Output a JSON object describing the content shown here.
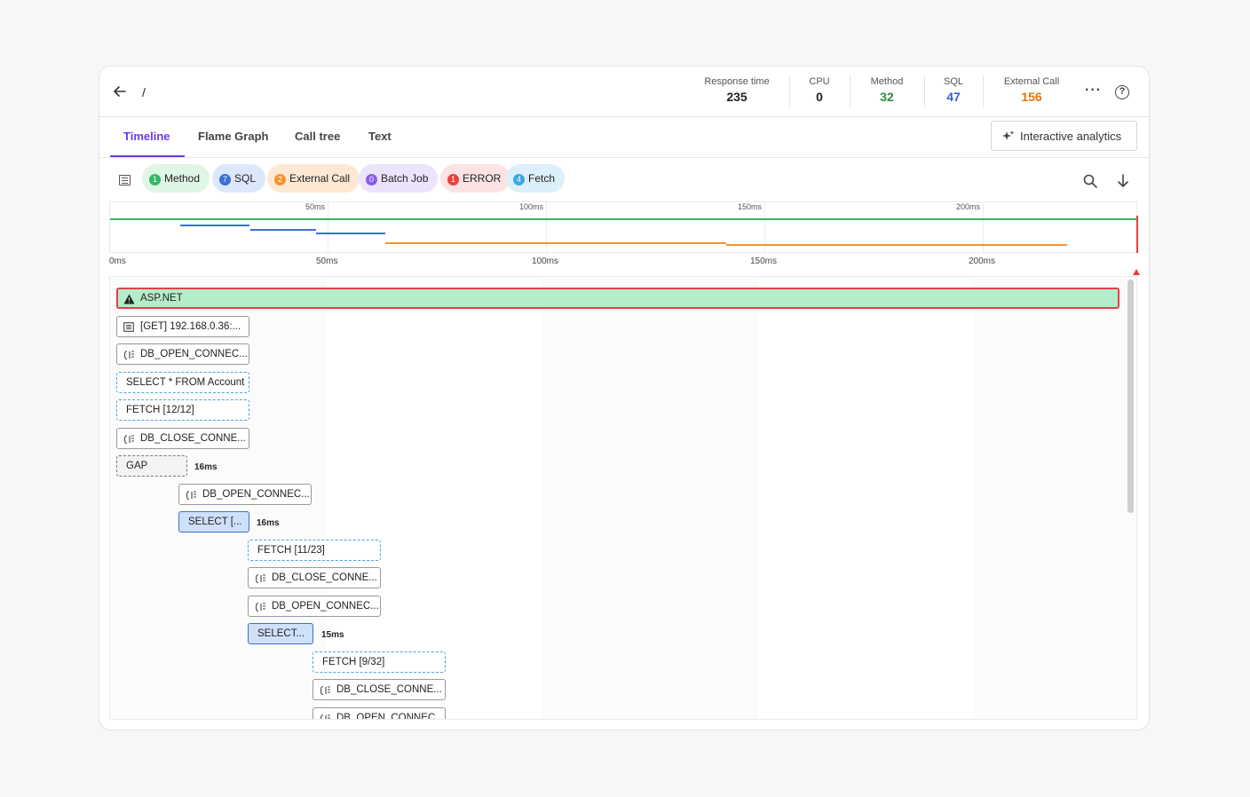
{
  "header": {
    "path": "/",
    "metrics": [
      {
        "label": "Response time",
        "value": "235",
        "color": "#222222"
      },
      {
        "label": "CPU",
        "value": "0",
        "color": "#222222"
      },
      {
        "label": "Method",
        "value": "32",
        "color": "#2e8b3c"
      },
      {
        "label": "SQL",
        "value": "47",
        "color": "#2f5fd6"
      },
      {
        "label": "External Call",
        "value": "156",
        "color": "#e8720c"
      }
    ]
  },
  "tabs": [
    "Timeline",
    "Flame Graph",
    "Call tree",
    "Text"
  ],
  "interactive_analytics": "Interactive analytics",
  "filters": [
    {
      "count": "1",
      "label": "Method",
      "bg": "#dff5e6",
      "dot": "#36b964"
    },
    {
      "count": "7",
      "label": "SQL",
      "bg": "#dde7fb",
      "dot": "#3b6fd8"
    },
    {
      "count": "2",
      "label": "External Call",
      "bg": "#fde9d3",
      "dot": "#f0952e"
    },
    {
      "count": "0",
      "label": "Batch Job",
      "bg": "#ece4fc",
      "dot": "#8a5cf0"
    },
    {
      "count": "1",
      "label": "ERROR",
      "bg": "#fde3e4",
      "dot": "#e8433b"
    },
    {
      "count": "4",
      "label": "Fetch",
      "bg": "#dcf0fb",
      "dot": "#3aa8e3"
    }
  ],
  "overview_ticks": [
    "50ms",
    "100ms",
    "150ms",
    "200ms"
  ],
  "axis_ticks": [
    "0ms",
    "50ms",
    "100ms",
    "150ms",
    "200ms"
  ],
  "bars": {
    "b0": "ASP.NET",
    "b1": "[GET] 192.168.0.36:...",
    "b2": "DB_OPEN_CONNEC...",
    "b3": "SELECT * FROM Account",
    "b4": "FETCH [12/12]",
    "b5": "DB_CLOSE_CONNE...",
    "b6": "GAP",
    "b7": "DB_OPEN_CONNEC...",
    "b8": "SELECT [...",
    "b9": "FETCH [11/23]",
    "b10": "DB_CLOSE_CONNE...",
    "b11": "DB_OPEN_CONNEC...",
    "b12": "SELECT...",
    "b13": "FETCH [9/32]",
    "b14": "DB_CLOSE_CONNE...",
    "b15": "DB_OPEN_CONNEC..."
  },
  "durations": {
    "d6": "16ms",
    "d8": "16ms",
    "d12": "15ms"
  }
}
